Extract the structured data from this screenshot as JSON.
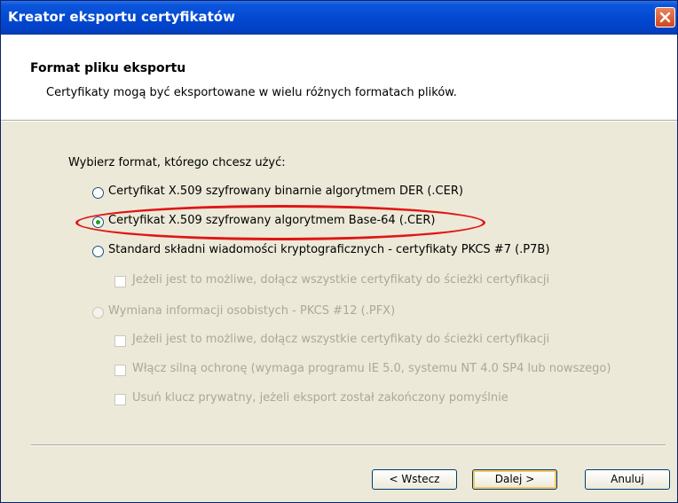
{
  "window": {
    "title": "Kreator eksportu certyfikatów"
  },
  "header": {
    "title": "Format pliku eksportu",
    "subtitle": "Certyfikaty mogą być eksportowane w wielu różnych formatach plików."
  },
  "main": {
    "prompt": "Wybierz format, którego chcesz użyć:",
    "options": [
      {
        "label": "Certyfikat X.509 szyfrowany binarnie algorytmem DER (.CER)",
        "selected": false,
        "enabled": true
      },
      {
        "label": "Certyfikat X.509 szyfrowany algorytmem Base-64 (.CER)",
        "selected": true,
        "enabled": true
      },
      {
        "label": "Standard składni wiadomości kryptograficznych - certyfikaty PKCS #7 (.P7B)",
        "selected": false,
        "enabled": true
      },
      {
        "label": "Wymiana informacji osobistych - PKCS #12 (.PFX)",
        "selected": false,
        "enabled": false
      }
    ],
    "checkboxes": [
      {
        "label": "Jeżeli jest to możliwe, dołącz wszystkie certyfikaty do ścieżki certyfikacji",
        "enabled": false,
        "checked": false
      },
      {
        "label": "Jeżeli jest to możliwe, dołącz wszystkie certyfikaty do ścieżki certyfikacji",
        "enabled": false,
        "checked": false
      },
      {
        "label": "Włącz silną ochronę (wymaga programu IE 5.0, systemu NT 4.0 SP4 lub nowszego)",
        "enabled": false,
        "checked": false
      },
      {
        "label": "Usuń klucz prywatny, jeżeli eksport został zakończony pomyślnie",
        "enabled": false,
        "checked": false
      }
    ]
  },
  "buttons": {
    "back": "< Wstecz",
    "next": "Dalej >",
    "cancel": "Anuluj"
  },
  "colors": {
    "titlebar": "#0349d2",
    "face": "#ece9d8",
    "highlight": "#e01616"
  }
}
